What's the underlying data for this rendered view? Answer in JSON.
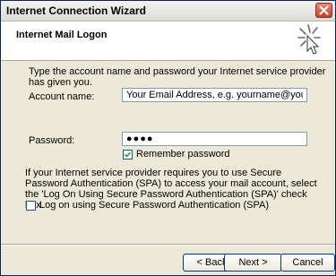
{
  "window": {
    "title": "Internet Connection Wizard"
  },
  "header": {
    "title": "Internet Mail Logon"
  },
  "form": {
    "instruction": "Type the account name and password your Internet service provider has given you.",
    "account_label": "Account name:",
    "account_value": "Your Email Address, e.g. yourname@yourdomain.com",
    "password_label": "Password:",
    "password_value": "●●●●",
    "remember_label": "Remember password",
    "remember_checked": true,
    "spa_text": "If your Internet service provider requires you to use Secure Password Authentication (SPA) to access your mail account, select the 'Log On Using Secure Password Authentication (SPA)' check box.",
    "spa_label": "Log on using Secure Password Authentication (SPA)",
    "spa_checked": false
  },
  "buttons": {
    "back": "< Back",
    "next": "Next >",
    "cancel": "Cancel"
  },
  "icons": {
    "close": "close-icon",
    "wizard": "wizard-sparkle-icon",
    "check": "checkmark-icon"
  }
}
